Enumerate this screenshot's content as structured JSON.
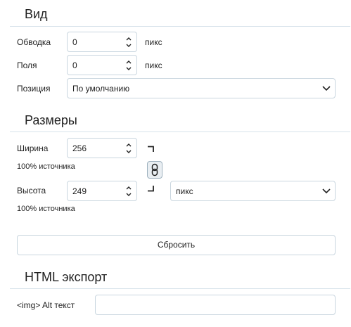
{
  "view": {
    "title": "Вид",
    "stroke": {
      "label": "Обводка",
      "value": "0",
      "unit": "пикс"
    },
    "margins": {
      "label": "Поля",
      "value": "0",
      "unit": "пикс"
    },
    "position": {
      "label": "Позиция",
      "value": "По умолчанию"
    }
  },
  "size": {
    "title": "Размеры",
    "width": {
      "label": "Ширина",
      "value": "256",
      "note": "100% источника"
    },
    "height": {
      "label": "Высота",
      "value": "249",
      "note": "100% источника"
    },
    "unit_select": {
      "value": "пикс"
    },
    "reset_label": "Сбросить"
  },
  "export": {
    "title": "HTML экспорт",
    "alt_label": "<img> Alt текст",
    "alt_value": ""
  }
}
